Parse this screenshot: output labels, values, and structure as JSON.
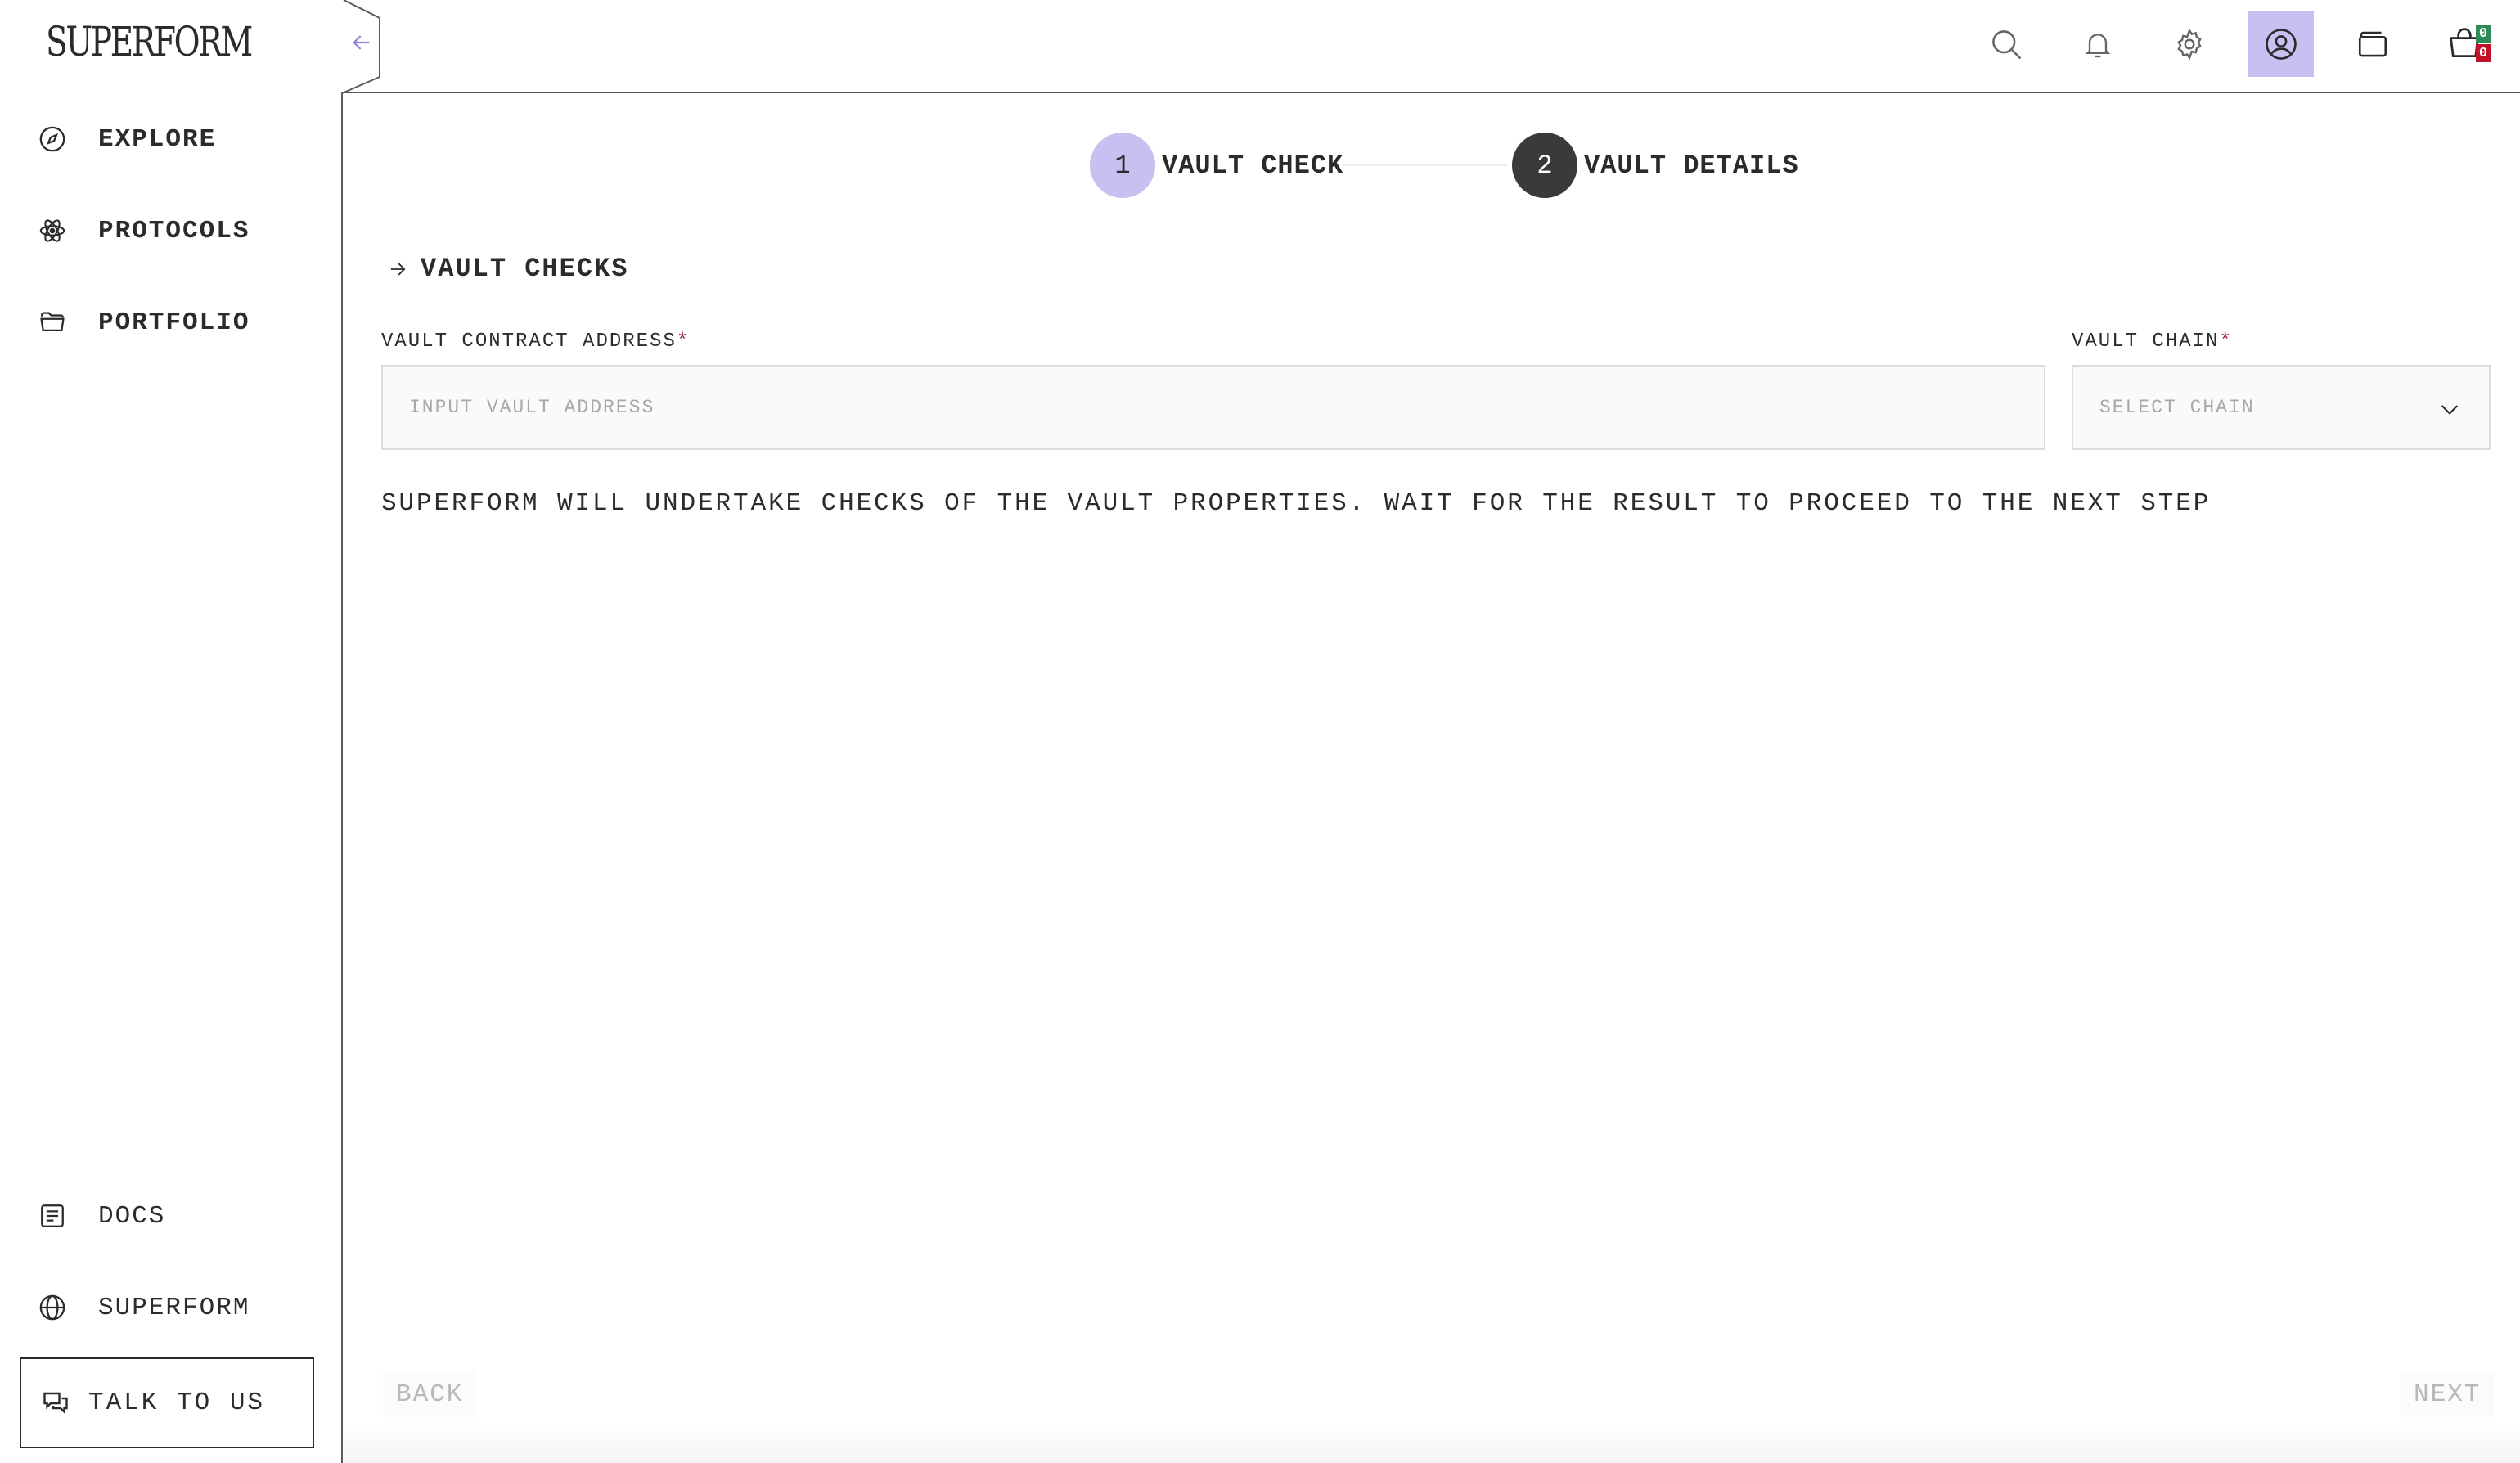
{
  "app": {
    "logo_text": "SUPERFORM"
  },
  "sidebar": {
    "nav": [
      {
        "label": "EXPLORE",
        "icon": "compass-icon"
      },
      {
        "label": "PROTOCOLS",
        "icon": "atom-icon"
      },
      {
        "label": "PORTFOLIO",
        "icon": "folder-icon"
      }
    ],
    "bottom": [
      {
        "label": "DOCS",
        "icon": "document-icon"
      },
      {
        "label": "SUPERFORM",
        "icon": "globe-icon"
      }
    ],
    "talk_label": "TALK TO US"
  },
  "topbar": {
    "icons": [
      "search-icon",
      "bell-icon",
      "gear-icon",
      "user-icon",
      "wallet-icon",
      "cart-icon"
    ],
    "active_icon": "user-icon",
    "cart_badges": {
      "top": "0",
      "bottom": "0"
    },
    "colors": {
      "badge_top": "#2e8b57",
      "badge_bottom": "#c0112b",
      "active_bg": "#c9bff0"
    }
  },
  "stepper": {
    "steps": [
      {
        "number": "1",
        "label": "VAULT CHECK",
        "state": "current"
      },
      {
        "number": "2",
        "label": "VAULT DETAILS",
        "state": "upcoming"
      }
    ]
  },
  "form": {
    "section_title": "VAULT CHECKS",
    "address_label": "VAULT CONTRACT ADDRESS",
    "address_placeholder": "INPUT VAULT ADDRESS",
    "address_value": "",
    "chain_label": "VAULT CHAIN",
    "chain_placeholder": "SELECT CHAIN",
    "required_mark": "*",
    "info": "SUPERFORM WILL UNDERTAKE CHECKS OF THE VAULT PROPERTIES. WAIT FOR THE RESULT TO PROCEED TO THE NEXT STEP"
  },
  "footer": {
    "back_label": "BACK",
    "next_label": "NEXT"
  }
}
